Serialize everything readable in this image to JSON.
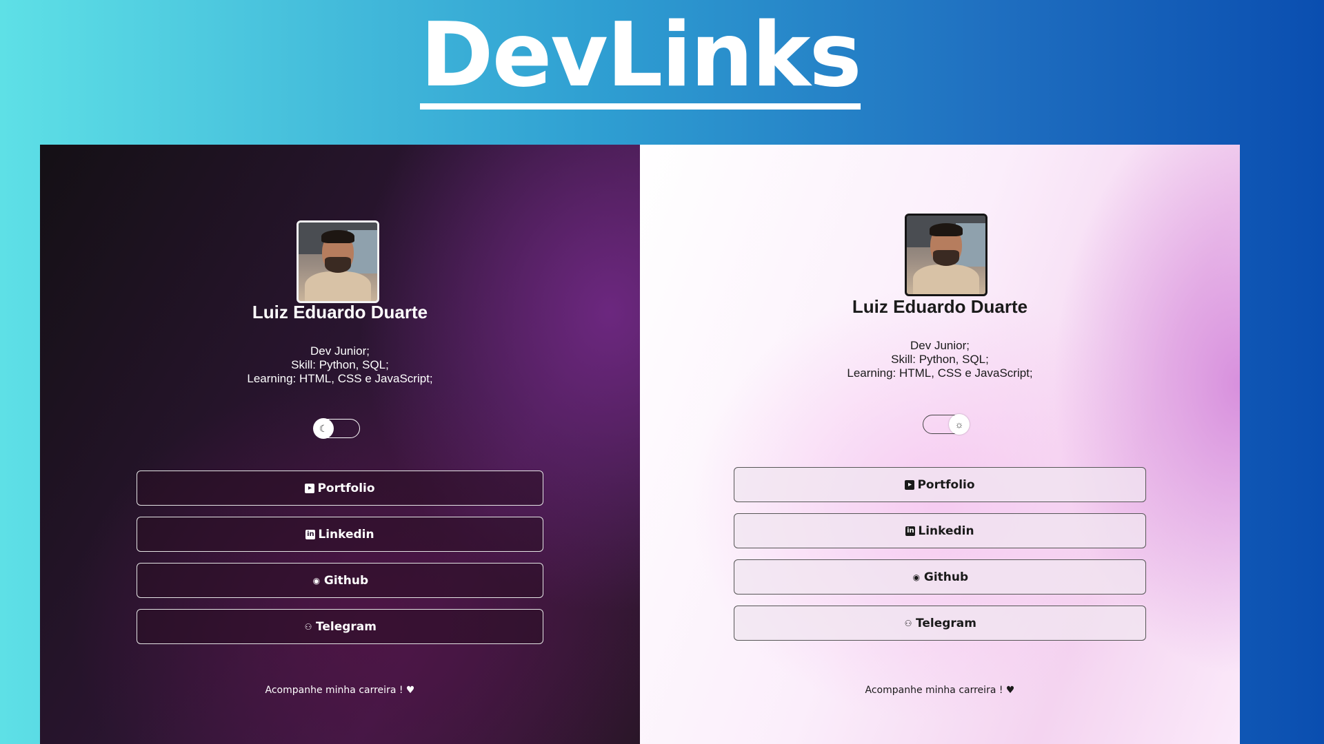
{
  "page": {
    "title": "DevLinks"
  },
  "dark_panel": {
    "name": "Luiz Eduardo Duarte",
    "bio": [
      "Dev Junior;",
      "Skill: Python, SQL;",
      "Learning: HTML, CSS e JavaScript;"
    ],
    "toggle_icon": "moon-icon",
    "links": [
      {
        "label": "Portfolio",
        "icon": "portfolio-icon"
      },
      {
        "label": "Linkedin",
        "icon": "linkedin-icon"
      },
      {
        "label": "Github",
        "icon": "github-icon"
      },
      {
        "label": "Telegram",
        "icon": "telegram-icon"
      }
    ],
    "footer": "Acompanhe minha carreira ! ♥"
  },
  "light_panel": {
    "name": "Luiz Eduardo Duarte",
    "bio": [
      "Dev Junior;",
      "Skill: Python, SQL;",
      "Learning: HTML, CSS e JavaScript;"
    ],
    "toggle_icon": "sun-icon",
    "links": [
      {
        "label": "Portfolio",
        "icon": "portfolio-icon"
      },
      {
        "label": "Linkedin",
        "icon": "linkedin-icon"
      },
      {
        "label": "Github",
        "icon": "github-icon"
      },
      {
        "label": "Telegram",
        "icon": "telegram-icon"
      }
    ],
    "footer": "Acompanhe minha carreira ! ♥"
  },
  "colors": {
    "bg_left": "#5ee0e6",
    "bg_right": "#0a4eb0",
    "dark_accent": "#3f1a45",
    "light_accent": "#f4d4f0"
  }
}
